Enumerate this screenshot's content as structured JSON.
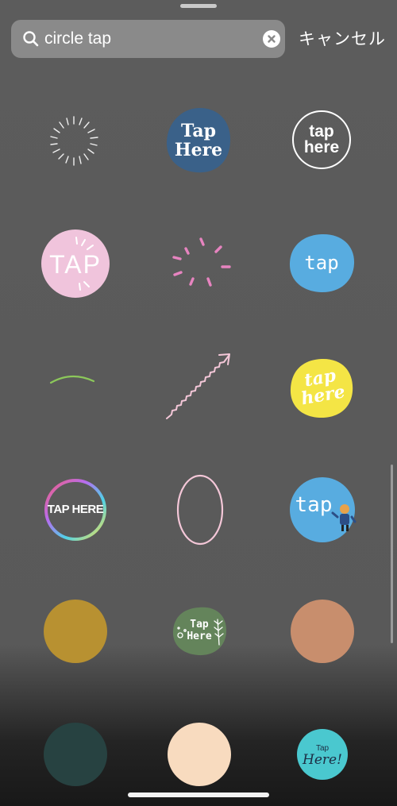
{
  "search": {
    "query": "circle tap",
    "cancel_label": "キャンセル"
  },
  "stickers": {
    "tap_here_blue_line1": "Tap",
    "tap_here_blue_line2": "Here",
    "tap_here_outline_line1": "tap",
    "tap_here_outline_line2": "here",
    "tap_pink": "TAP",
    "tap_blue": "tap",
    "tap_here_yellow_line1": "tap",
    "tap_here_yellow_line2": "here",
    "tap_here_gradient": "TAP HERE",
    "tap_mascot": "tap",
    "tap_here_green_line1": "Tap",
    "tap_here_green_line2": "Here",
    "tap_here_teal_line1": "Tap",
    "tap_here_teal_line2": "Here!"
  },
  "colors": {
    "navy_blob": "#3a6189",
    "pink_circle": "#f0c4dc",
    "sky_blue": "#58ace0",
    "yellow": "#f4e545",
    "mustard": "#b89131",
    "sage_green": "#64845b",
    "terracotta": "#c88e6d",
    "dark_teal": "#274241",
    "peach": "#f8dbbf",
    "turquoise": "#4ac8cf"
  }
}
